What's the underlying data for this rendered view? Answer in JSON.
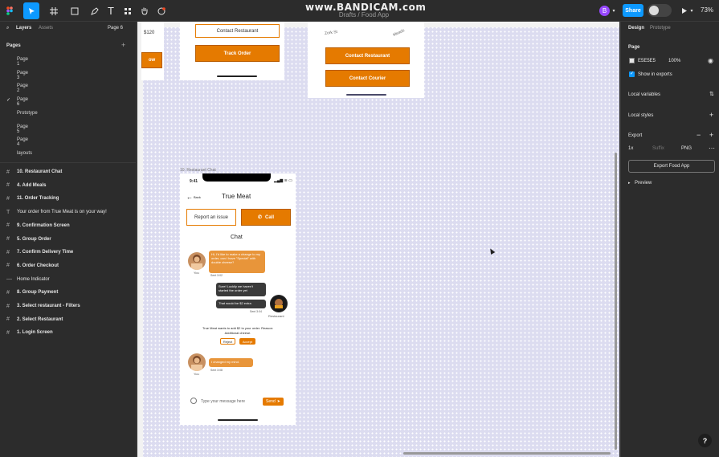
{
  "toolbar": {
    "watermark": "www.BANDICAM.com",
    "doc_name": "Drafts / Food App",
    "avatar_letter": "B",
    "share_label": "Share",
    "zoom": "73%"
  },
  "left_panel": {
    "tabs": {
      "layers": "Layers",
      "assets": "Assets",
      "current_page": "Page 6"
    },
    "pages_title": "Pages",
    "pages": [
      "Page 1",
      "Page 3",
      "Page 2",
      "Page 6",
      "Prototype",
      "Page 5",
      "Page 4",
      "layouts"
    ],
    "active_page_index": 3,
    "layers": [
      {
        "label": "10. Restaurant Chat",
        "type": "frame"
      },
      {
        "label": "4. Add Meals",
        "type": "frame"
      },
      {
        "label": "11. Order Tracking",
        "type": "frame"
      },
      {
        "label": "Your order from True Meat is on your way!",
        "type": "text"
      },
      {
        "label": "9. Confirmation Screen",
        "type": "frame"
      },
      {
        "label": "5. Group Order",
        "type": "frame"
      },
      {
        "label": "7. Confirm Delivery Time",
        "type": "frame"
      },
      {
        "label": "6. Order Checkout",
        "type": "frame"
      },
      {
        "label": "Home Indicator",
        "type": "component"
      },
      {
        "label": "8. Group Payment",
        "type": "frame"
      },
      {
        "label": "3. Select restaurant - Filters",
        "type": "frame"
      },
      {
        "label": "2. Select Restaurant",
        "type": "frame"
      },
      {
        "label": "1. Login Screen",
        "type": "frame"
      }
    ]
  },
  "right_panel": {
    "tabs": {
      "design": "Design",
      "prototype": "Prototype"
    },
    "page_section": "Page",
    "page_color": "E5E5E5",
    "page_opacity": "100%",
    "show_in_exports": "Show in exports",
    "local_variables": "Local variables",
    "local_styles": "Local styles",
    "export_title": "Export",
    "export_scale": "1x",
    "export_suffix": "Suffix",
    "export_format": "PNG",
    "export_button": "Export Food App",
    "preview": "Preview",
    "help": "?"
  },
  "canvas": {
    "top_left_frame": {
      "price": "$120",
      "partial_button": "ow"
    },
    "track_frame": {
      "contact_button": "Contact Restaurant",
      "track_button": "Track Order"
    },
    "contact_frame": {
      "street_a": "Zork St",
      "street_b": "Meads",
      "contact_restaurant": "Contact Restaurant",
      "contact_courier": "Contact Courier"
    },
    "chat_frame": {
      "label": "10. Restaurant Chat",
      "time": "9:41",
      "back": "Back",
      "title": "True Meat",
      "report": "Report an issue",
      "call": "Call",
      "chat_heading": "Chat",
      "msg1": "Hi, I'd like to make a change to my order, can I have \"Special\" with double cheese?",
      "msg1_meta": "Sent 3:02",
      "you_label_1": "You",
      "msg2": "Sure! Luckily we haven't started the order yet",
      "msg3": "That would be $2 extra",
      "msg3_meta": "Sent 3:04",
      "restaurant_label": "Restaurant",
      "notice": "True Meat wants to add $2 to your order. Reason: Additional cheese.",
      "reject": "Reject",
      "accept": "Accept",
      "msg4": "I changed my mind.",
      "msg4_meta": "Sent 3:08",
      "you_label_2": "You",
      "input_placeholder": "Type your message here",
      "send": "Send"
    }
  },
  "colors": {
    "accent": "#0d99ff",
    "orange": "#e57a00",
    "canvas": "#e5e5e5"
  }
}
